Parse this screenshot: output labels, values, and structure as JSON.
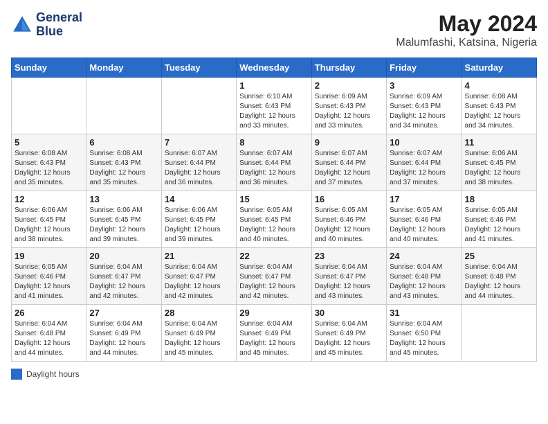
{
  "header": {
    "logo_line1": "General",
    "logo_line2": "Blue",
    "main_title": "May 2024",
    "subtitle": "Malumfashi, Katsina, Nigeria"
  },
  "calendar": {
    "days_of_week": [
      "Sunday",
      "Monday",
      "Tuesday",
      "Wednesday",
      "Thursday",
      "Friday",
      "Saturday"
    ],
    "weeks": [
      [
        {
          "day": "",
          "info": ""
        },
        {
          "day": "",
          "info": ""
        },
        {
          "day": "",
          "info": ""
        },
        {
          "day": "1",
          "info": "Sunrise: 6:10 AM\nSunset: 6:43 PM\nDaylight: 12 hours\nand 33 minutes."
        },
        {
          "day": "2",
          "info": "Sunrise: 6:09 AM\nSunset: 6:43 PM\nDaylight: 12 hours\nand 33 minutes."
        },
        {
          "day": "3",
          "info": "Sunrise: 6:09 AM\nSunset: 6:43 PM\nDaylight: 12 hours\nand 34 minutes."
        },
        {
          "day": "4",
          "info": "Sunrise: 6:08 AM\nSunset: 6:43 PM\nDaylight: 12 hours\nand 34 minutes."
        }
      ],
      [
        {
          "day": "5",
          "info": "Sunrise: 6:08 AM\nSunset: 6:43 PM\nDaylight: 12 hours\nand 35 minutes."
        },
        {
          "day": "6",
          "info": "Sunrise: 6:08 AM\nSunset: 6:43 PM\nDaylight: 12 hours\nand 35 minutes."
        },
        {
          "day": "7",
          "info": "Sunrise: 6:07 AM\nSunset: 6:44 PM\nDaylight: 12 hours\nand 36 minutes."
        },
        {
          "day": "8",
          "info": "Sunrise: 6:07 AM\nSunset: 6:44 PM\nDaylight: 12 hours\nand 36 minutes."
        },
        {
          "day": "9",
          "info": "Sunrise: 6:07 AM\nSunset: 6:44 PM\nDaylight: 12 hours\nand 37 minutes."
        },
        {
          "day": "10",
          "info": "Sunrise: 6:07 AM\nSunset: 6:44 PM\nDaylight: 12 hours\nand 37 minutes."
        },
        {
          "day": "11",
          "info": "Sunrise: 6:06 AM\nSunset: 6:45 PM\nDaylight: 12 hours\nand 38 minutes."
        }
      ],
      [
        {
          "day": "12",
          "info": "Sunrise: 6:06 AM\nSunset: 6:45 PM\nDaylight: 12 hours\nand 38 minutes."
        },
        {
          "day": "13",
          "info": "Sunrise: 6:06 AM\nSunset: 6:45 PM\nDaylight: 12 hours\nand 39 minutes."
        },
        {
          "day": "14",
          "info": "Sunrise: 6:06 AM\nSunset: 6:45 PM\nDaylight: 12 hours\nand 39 minutes."
        },
        {
          "day": "15",
          "info": "Sunrise: 6:05 AM\nSunset: 6:45 PM\nDaylight: 12 hours\nand 40 minutes."
        },
        {
          "day": "16",
          "info": "Sunrise: 6:05 AM\nSunset: 6:46 PM\nDaylight: 12 hours\nand 40 minutes."
        },
        {
          "day": "17",
          "info": "Sunrise: 6:05 AM\nSunset: 6:46 PM\nDaylight: 12 hours\nand 40 minutes."
        },
        {
          "day": "18",
          "info": "Sunrise: 6:05 AM\nSunset: 6:46 PM\nDaylight: 12 hours\nand 41 minutes."
        }
      ],
      [
        {
          "day": "19",
          "info": "Sunrise: 6:05 AM\nSunset: 6:46 PM\nDaylight: 12 hours\nand 41 minutes."
        },
        {
          "day": "20",
          "info": "Sunrise: 6:04 AM\nSunset: 6:47 PM\nDaylight: 12 hours\nand 42 minutes."
        },
        {
          "day": "21",
          "info": "Sunrise: 6:04 AM\nSunset: 6:47 PM\nDaylight: 12 hours\nand 42 minutes."
        },
        {
          "day": "22",
          "info": "Sunrise: 6:04 AM\nSunset: 6:47 PM\nDaylight: 12 hours\nand 42 minutes."
        },
        {
          "day": "23",
          "info": "Sunrise: 6:04 AM\nSunset: 6:47 PM\nDaylight: 12 hours\nand 43 minutes."
        },
        {
          "day": "24",
          "info": "Sunrise: 6:04 AM\nSunset: 6:48 PM\nDaylight: 12 hours\nand 43 minutes."
        },
        {
          "day": "25",
          "info": "Sunrise: 6:04 AM\nSunset: 6:48 PM\nDaylight: 12 hours\nand 44 minutes."
        }
      ],
      [
        {
          "day": "26",
          "info": "Sunrise: 6:04 AM\nSunset: 6:48 PM\nDaylight: 12 hours\nand 44 minutes."
        },
        {
          "day": "27",
          "info": "Sunrise: 6:04 AM\nSunset: 6:49 PM\nDaylight: 12 hours\nand 44 minutes."
        },
        {
          "day": "28",
          "info": "Sunrise: 6:04 AM\nSunset: 6:49 PM\nDaylight: 12 hours\nand 45 minutes."
        },
        {
          "day": "29",
          "info": "Sunrise: 6:04 AM\nSunset: 6:49 PM\nDaylight: 12 hours\nand 45 minutes."
        },
        {
          "day": "30",
          "info": "Sunrise: 6:04 AM\nSunset: 6:49 PM\nDaylight: 12 hours\nand 45 minutes."
        },
        {
          "day": "31",
          "info": "Sunrise: 6:04 AM\nSunset: 6:50 PM\nDaylight: 12 hours\nand 45 minutes."
        },
        {
          "day": "",
          "info": ""
        }
      ]
    ]
  },
  "legend": {
    "label": "Daylight hours"
  }
}
